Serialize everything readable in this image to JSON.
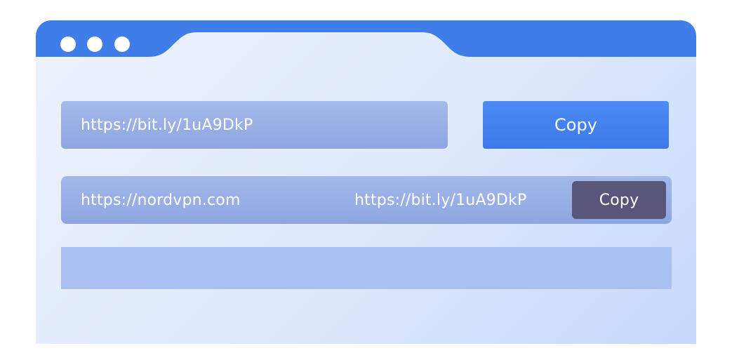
{
  "window": {
    "controls": [
      "dot-icon",
      "dot-icon",
      "dot-icon"
    ]
  },
  "shortener": {
    "input_value": "https://bit.ly/1uA9DkP",
    "copy_label": "Copy"
  },
  "result": {
    "original_url": "https://nordvpn.com",
    "short_url": "https://bit.ly/1uA9DkP",
    "copy_label": "Copy"
  },
  "colors": {
    "titlebar": "#3f7de8",
    "primary_button": "#4484f0",
    "secondary_button": "#58577a",
    "field": "#9cb2e8",
    "empty_row": "#aac0f0"
  }
}
